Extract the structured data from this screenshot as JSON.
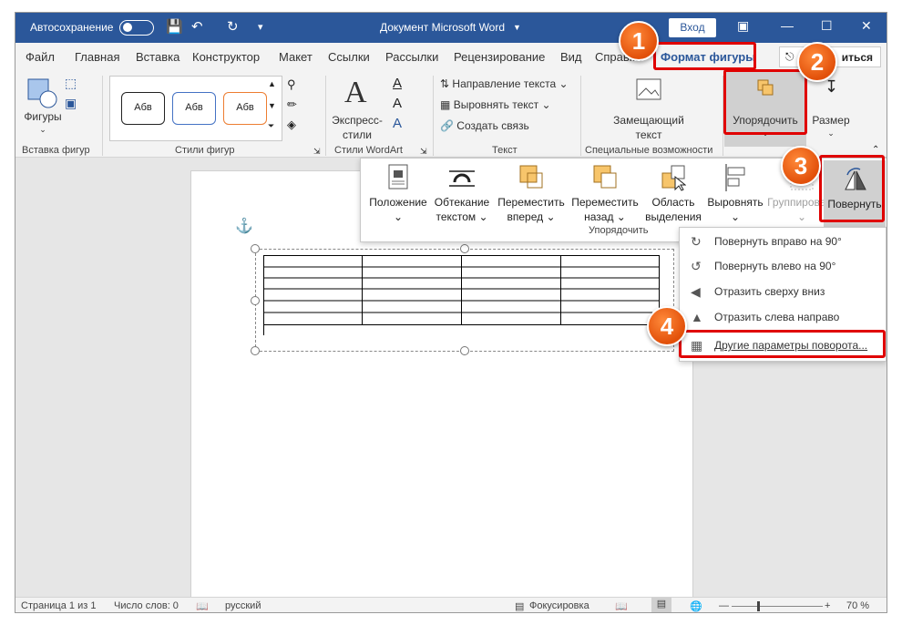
{
  "titlebar": {
    "autosave": "Автосохранение",
    "doc_title": "Документ Microsoft Word",
    "login": "Вход"
  },
  "tabs": [
    "Файл",
    "Главная",
    "Вставка",
    "Конструктор",
    "Макет",
    "Ссылки",
    "Рассылки",
    "Рецензирование",
    "Вид",
    "Справка",
    "Формат фигуры"
  ],
  "share_label": "иться",
  "ribbon": {
    "shapes_label": "Фигуры",
    "insert_shapes_group": "Вставка фигур",
    "style_sample": "Абв",
    "shape_styles_group": "Стили фигур",
    "express_styles": "Экспресс-",
    "express_styles2": "стили",
    "wordart_group": "Стили WordArt",
    "text_direction": "Направление текста",
    "align_text": "Выровнять текст",
    "create_link": "Создать связь",
    "text_group": "Текст",
    "alt_text": "Замещающий",
    "alt_text2": "текст",
    "accessibility_group": "Специальные возможности",
    "arrange": "Упорядочить",
    "size": "Размер"
  },
  "arrange_menu": {
    "items": [
      {
        "line1": "Положение",
        "line2": "⌄"
      },
      {
        "line1": "Обтекание",
        "line2": "текстом ⌄"
      },
      {
        "line1": "Переместить",
        "line2": "вперед ⌄"
      },
      {
        "line1": "Переместить",
        "line2": "назад ⌄"
      },
      {
        "line1": "Область",
        "line2": "выделения"
      },
      {
        "line1": "Выровнять",
        "line2": "⌄"
      },
      {
        "line1": "Группировать",
        "line2": "⌄"
      },
      {
        "line1": "Повернуть",
        "line2": "⌄"
      }
    ],
    "group_label": "Упорядочить"
  },
  "rotate_menu": [
    "Повернуть вправо на 90°",
    "Повернуть влево на 90°",
    "Отразить сверху вниз",
    "Отразить слева направо",
    "Другие параметры поворота..."
  ],
  "markers": [
    "1",
    "2",
    "3",
    "4"
  ],
  "status": {
    "page": "Страница 1 из 1",
    "words": "Число слов: 0",
    "lang": "русский",
    "focus": "Фокусировка",
    "zoom": "70 %"
  },
  "colors": {
    "accent": "#2b579a",
    "highlight": "#e00000",
    "marker": "#e2500a"
  }
}
